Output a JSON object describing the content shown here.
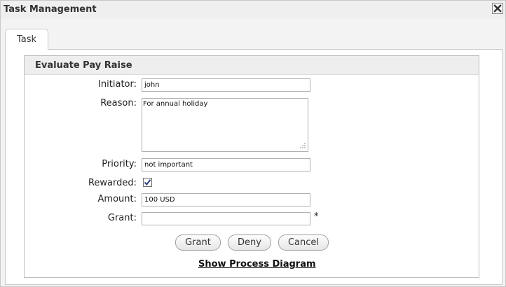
{
  "window": {
    "title": "Task Management"
  },
  "tabs": [
    {
      "label": "Task"
    }
  ],
  "form": {
    "heading": "Evaluate Pay Raise",
    "initiator": {
      "label": "Initiator:",
      "value": "john"
    },
    "reason": {
      "label": "Reason:",
      "value": "For annual holiday"
    },
    "priority": {
      "label": "Priority:",
      "value": "not important"
    },
    "rewarded": {
      "label": "Rewarded:",
      "checked": true
    },
    "amount": {
      "label": "Amount:",
      "value": "100 USD"
    },
    "grant": {
      "label": "Grant:",
      "value": "",
      "required_marker": "*"
    }
  },
  "actions": {
    "grant": "Grant",
    "deny": "Deny",
    "cancel": "Cancel"
  },
  "link": {
    "label": "Show Process Diagram"
  },
  "icons": {
    "close": "close-icon",
    "check": "check-icon",
    "resize": "resize-grip-icon"
  }
}
